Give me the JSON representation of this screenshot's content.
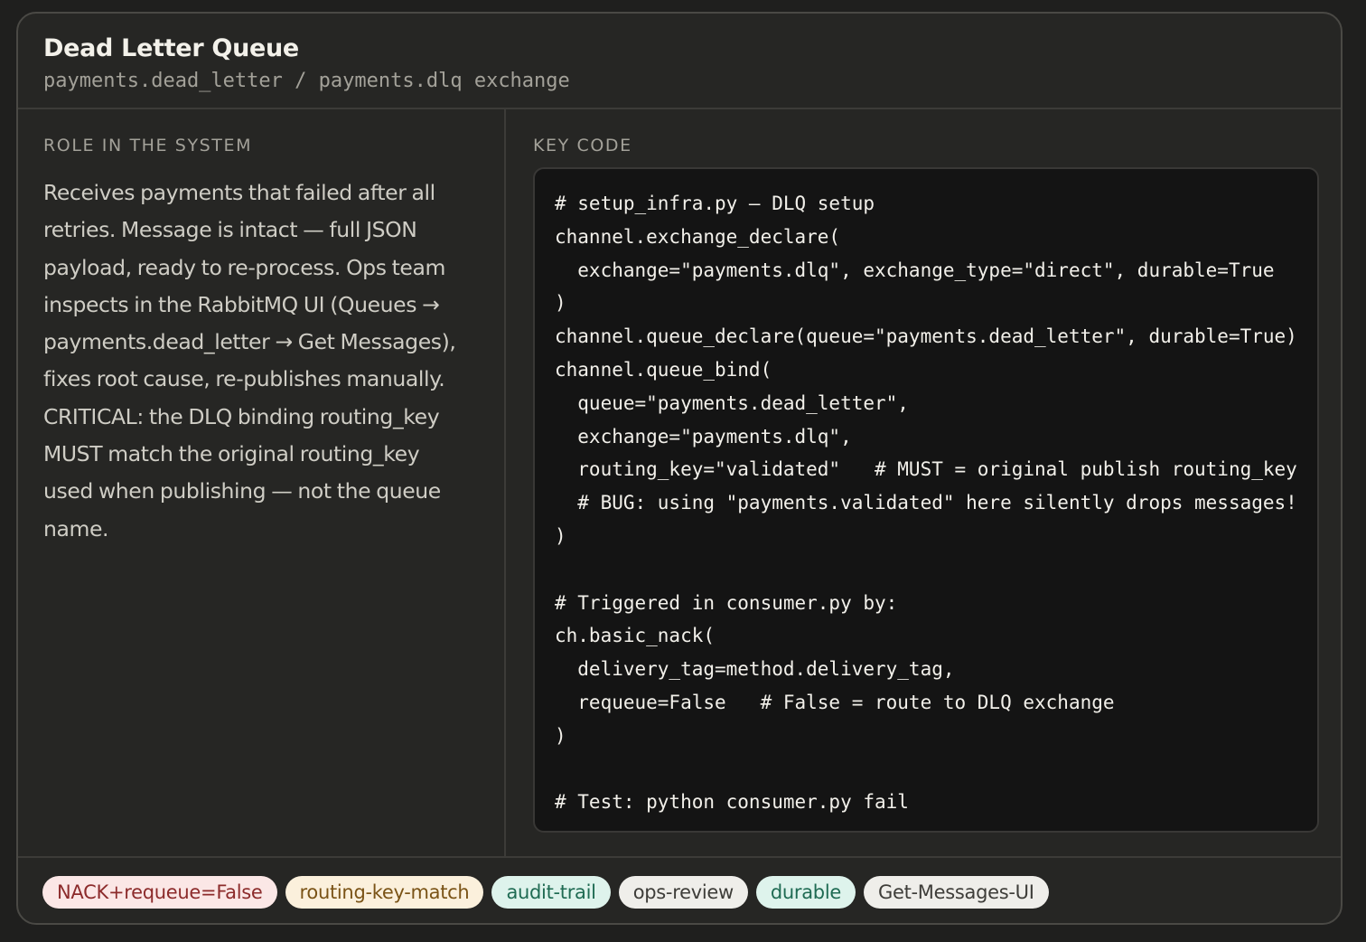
{
  "header": {
    "title": "Dead Letter Queue",
    "subtitle": "payments.dead_letter / payments.dlq exchange"
  },
  "role": {
    "label": "ROLE IN THE SYSTEM",
    "lines": [
      "Receives payments that failed after all",
      "retries. Message is intact — full JSON",
      "payload, ready to re-process. Ops team",
      "inspects in the RabbitMQ UI (Queues →",
      "payments.dead_letter → Get Messages),",
      "fixes root cause, re-publishes manually.",
      "CRITICAL: the DLQ binding routing_key",
      "MUST match the original routing_key",
      "used when publishing — not the queue",
      "name."
    ]
  },
  "code": {
    "label": "KEY CODE",
    "lines": [
      "# setup_infra.py — DLQ setup",
      "channel.exchange_declare(",
      "  exchange=\"payments.dlq\", exchange_type=\"direct\", durable=True",
      ")",
      "channel.queue_declare(queue=\"payments.dead_letter\", durable=True)",
      "channel.queue_bind(",
      "  queue=\"payments.dead_letter\",",
      "  exchange=\"payments.dlq\",",
      "  routing_key=\"validated\"   # MUST = original publish routing_key",
      "  # BUG: using \"payments.validated\" here silently drops messages!",
      ")",
      "",
      "# Triggered in consumer.py by:",
      "ch.basic_nack(",
      "  delivery_tag=method.delivery_tag,",
      "  requeue=False   # False = route to DLQ exchange",
      ")",
      "",
      "# Test: python consumer.py fail"
    ]
  },
  "tags": [
    {
      "label": "NACK+requeue=False",
      "bg": "#fbe7e6",
      "fg": "#8c2b2b"
    },
    {
      "label": "routing-key-match",
      "bg": "#fbf0dc",
      "fg": "#7a5316"
    },
    {
      "label": "audit-trail",
      "bg": "#def3ec",
      "fg": "#1f6b53"
    },
    {
      "label": "ops-review",
      "bg": "#efeeea",
      "fg": "#3e3d39"
    },
    {
      "label": "durable",
      "bg": "#def3ec",
      "fg": "#1f6b53"
    },
    {
      "label": "Get-Messages-UI",
      "bg": "#efeeea",
      "fg": "#3e3d39"
    }
  ]
}
